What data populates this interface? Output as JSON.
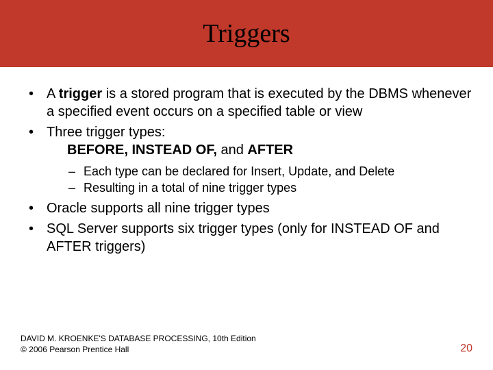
{
  "title": "Triggers",
  "bullets": {
    "b1_a": "A ",
    "b1_bold": "trigger",
    "b1_b": " is a stored program that is executed by the DBMS whenever a specified event occurs on a specified table or view",
    "b2": "Three trigger types:",
    "b2_indent_a": "BEFORE, INSTEAD OF, ",
    "b2_indent_b": "and ",
    "b2_indent_c": "AFTER",
    "sub1": "Each type can be declared for Insert, Update, and Delete",
    "sub2": "Resulting in a total of nine trigger types",
    "b3": "Oracle supports all nine trigger types",
    "b4": "SQL Server supports six trigger types (only for INSTEAD OF and AFTER triggers)"
  },
  "footer": {
    "line1": "DAVID M. KROENKE'S DATABASE PROCESSING, 10th Edition",
    "line2": "© 2006 Pearson Prentice Hall",
    "page": "20"
  }
}
